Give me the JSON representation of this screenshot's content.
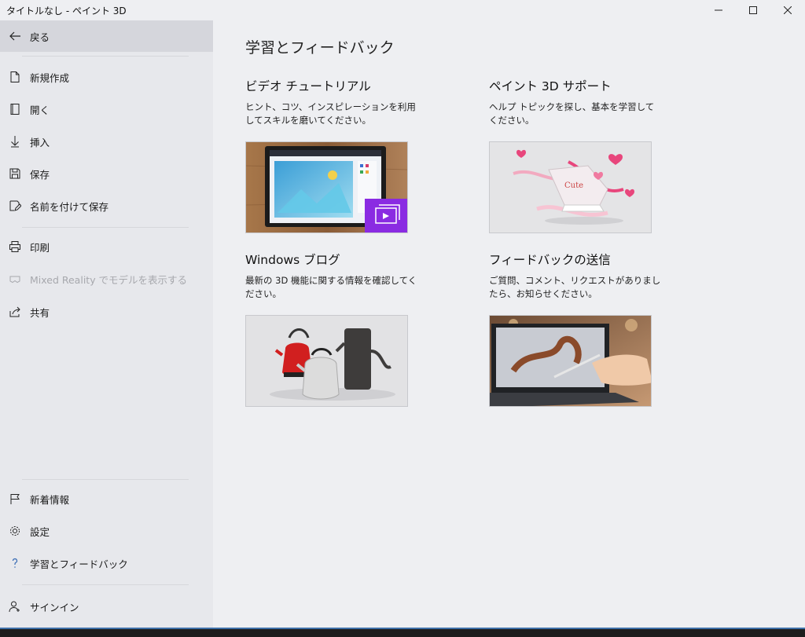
{
  "window": {
    "title": "タイトルなし - ペイント 3D"
  },
  "sidebar": {
    "back_label": "戻る",
    "top_items": [
      {
        "label": "新規作成"
      },
      {
        "label": "開く"
      },
      {
        "label": "挿入"
      },
      {
        "label": "保存"
      },
      {
        "label": "名前を付けて保存"
      },
      {
        "label": "印刷"
      },
      {
        "label": "Mixed Reality でモデルを表示する"
      },
      {
        "label": "共有"
      }
    ],
    "bottom_items": [
      {
        "label": "新着情報"
      },
      {
        "label": "設定"
      },
      {
        "label": "学習とフィードバック"
      },
      {
        "label": "サインイン"
      }
    ]
  },
  "main": {
    "heading": "学習とフィードバック",
    "cards": [
      {
        "title": "ビデオ チュートリアル",
        "desc": "ヒント、コツ、インスピレーションを利用してスキルを磨いてください。"
      },
      {
        "title": "ペイント 3D サポート",
        "desc": "ヘルプ トピックを探し、基本を学習してください。"
      },
      {
        "title": "Windows ブログ",
        "desc": "最新の 3D 機能に関する情報を確認してください。"
      },
      {
        "title": "フィードバックの送信",
        "desc": "ご質問、コメント、リクエストがありましたら、お知らせください。"
      }
    ]
  },
  "colors": {
    "accent": "#8a2be2",
    "pink": "#e8467c",
    "sidebar_bg": "#e7e8ec",
    "active_bg": "#d5d6dc"
  }
}
